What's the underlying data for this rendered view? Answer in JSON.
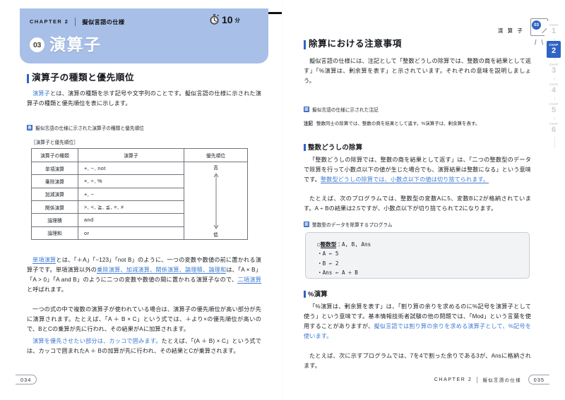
{
  "header": {
    "chapter_label": "CHAPTER 2",
    "chapter_subtitle": "擬似言語の仕様",
    "timer_value": "10",
    "timer_unit": "分",
    "section_number": "03",
    "section_title": "演算子",
    "stopwatch_icon": "stopwatch-icon"
  },
  "left_page": {
    "heading": "演算子の種類と優先順位",
    "para1": {
      "term": "演算子",
      "rest": "とは、演算の種類を示す記号や文字列のことです。擬似言語の仕様に示された演算子の種類と優先順位を表に示します。"
    },
    "figure_caption": {
      "marker": "表",
      "text": "擬似言語の仕様に示された演算子の種類と優先順位"
    },
    "table_name": "［演算子と優先順位］",
    "table": {
      "columns": [
        "演算子の種類",
        "演算子",
        "優先順位"
      ],
      "rows": [
        {
          "kind": "単項演算",
          "ops": "+, −, not"
        },
        {
          "kind": "乗除演算",
          "ops": "×, ÷, %"
        },
        {
          "kind": "加減演算",
          "ops": "+, −"
        },
        {
          "kind": "関係演算",
          "ops": ">, <, ≧, ≦, =, ≠"
        },
        {
          "kind": "論理積",
          "ops": "and"
        },
        {
          "kind": "論理和",
          "ops": "or"
        }
      ],
      "priority_high": "高",
      "priority_low": "低"
    },
    "para2": {
      "t1": "単項演算",
      "s1": "とは、「＋A」「−123」「not B」のように、一つの変数や数値の前に置かれる演算子です。単項演算以外の",
      "t2": "乗除演算、加減演算、関係演算、論理積、論理和",
      "s2": "は、「A × B」「A > 0」「A and B」のように二つの変数や数値の間に置かれる演算子なので、",
      "t3": "二項演算",
      "s3": "と呼ばれます。"
    },
    "para3": "一つの式の中で複数の演算子が使われている場合は、演算子の優先順位が高い部分が先に演算されます。たとえば、「A ＋ B × C」という式では、＋より×の優先順位が高いので、BとCの乗算が先に行われ、その結果がAに加算されます。",
    "para4": {
      "t1": "演算を優先させたい部分は、カッコで囲みます。",
      "s1": "たとえば、「(A ＋ B) × C」という式では、カッコで囲まれたA ＋ Bの加算が先に行われ、その結果とCが乗算されます。"
    },
    "folio": "034"
  },
  "right_page": {
    "running_head": "演 算 子",
    "badge_number": "03",
    "heading1": "除算における注意事項",
    "para1": "擬似言語の仕様には、注記として「整数どうしの除算では、整数の商を結果として返す」「%演算は、剰余算を表す」と示されています。それぞれの意味を説明しましょう。",
    "note_caption": {
      "marker": "図",
      "text": "擬似言語の仕様に示された注記"
    },
    "note_line": {
      "label": "注記",
      "text": "整数同士の除算では、整数の商を結果として返す。%演算子は、剰余算を表す。"
    },
    "heading2": "整数どうしの除算",
    "para2": {
      "s1": "「整数どうしの除算では、整数の商を結果として返す」は、「二つの整数型のデータで除算を行って小数点以下の値が生じた場合でも、演算結果は整数になる」という意味です。",
      "t1": "整数型どうしの除算では、小数点以下の値は切り捨てられます。"
    },
    "para3": "たとえば、次のプログラムでは、整数型の変数Aに5、変数Bに2が格納されています。A ÷ Bの結果は2.5ですが、小数点以下が切り捨てられて2になります。",
    "code_caption": {
      "marker": "図",
      "text": "整数型のデータを除算するプログラム"
    },
    "code": {
      "line1_kw": "整数型",
      "line1_rest": "：A, B, Ans",
      "line2": "・A ← 5",
      "line3": "・B ← 2",
      "line4": "・Ans ← A ÷ B"
    },
    "heading3": "%演算",
    "para4": {
      "s1": "「%演算は、剰余算を表す」は、「割り算の余りを求めるのに%記号を演算子として使う」という意味です。基本情報技術者試験の他の問題では、「Mod」という言葉を使用することがありますが、",
      "t1": "擬似言語では割り算の余りを求める演算子として、%記号を使います。"
    },
    "para5": "たとえば、次に示すプログラムでは、7を4で割った余りである3が、Ansに格納されます。",
    "folio": "035",
    "footer_chapter": "CHAPTER 2",
    "footer_subtitle": "擬似言語の仕様",
    "side_tabs": [
      {
        "label": "CHAP",
        "num": "1",
        "active": false
      },
      {
        "label": "CHAP",
        "num": "2",
        "active": true
      },
      {
        "label": "CHAP",
        "num": "3",
        "active": false
      },
      {
        "label": "CHAP",
        "num": "4",
        "active": false
      },
      {
        "label": "CHAP",
        "num": "5",
        "active": false
      },
      {
        "label": "CHAP",
        "num": "6",
        "active": false
      }
    ]
  },
  "colors": {
    "accent_blue": "#2f63c4",
    "header_band": "#a8bfe8",
    "link_blue": "#3e7ad1"
  }
}
